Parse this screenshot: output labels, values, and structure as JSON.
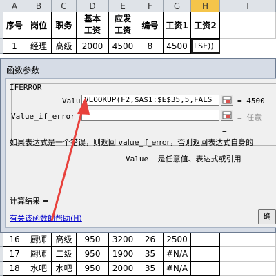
{
  "sheet": {
    "columns": [
      "A",
      "B",
      "C",
      "D",
      "E",
      "F",
      "G",
      "H",
      "I"
    ],
    "selected_column": "H",
    "header_row": [
      "序号",
      "岗位",
      "职务",
      "基本\n工资",
      "应发\n工资",
      "编号",
      "工资1",
      "工资2"
    ],
    "row2": [
      "1",
      "经理",
      "高级",
      "2000",
      "4500",
      "8",
      "4500",
      "LSE))"
    ],
    "bottom_rows": [
      [
        "16",
        "厨师",
        "高级",
        "950",
        "3200",
        "26",
        "2500",
        ""
      ],
      [
        "17",
        "厨师",
        "二级",
        "950",
        "1900",
        "35",
        "#N/A",
        ""
      ],
      [
        "18",
        "水吧",
        "水吧",
        "950",
        "2000",
        "35",
        "#N/A",
        ""
      ]
    ]
  },
  "dialog": {
    "title": "函数参数",
    "function_name": "IFERROR",
    "arg1_label": "Value",
    "arg1_value": "VLOOKUP(F2,$A$1:$E$35,5,FALS",
    "arg1_result": "= 4500",
    "arg2_label": "Value_if_error",
    "arg2_value": "",
    "arg2_result": "= 任意",
    "overall_eq": "=",
    "description_line1": "如果表达式是一个错误，则返回 value_if_error，否则返回表达式自身的",
    "description_value_label": "Value",
    "description_line2": "是任意值、表达式或引用",
    "result_label": "计算结果 =",
    "help_link": "有关该函数的帮助(H)",
    "ok_label": "确"
  },
  "colors": {
    "header_bg": "#dfe3e8",
    "selected_header": "#f5c54a",
    "dialog_frame": "#d6dce6",
    "dialog_body": "#f0f0f0",
    "arrow": "#e8413c",
    "link": "#0000cc"
  }
}
